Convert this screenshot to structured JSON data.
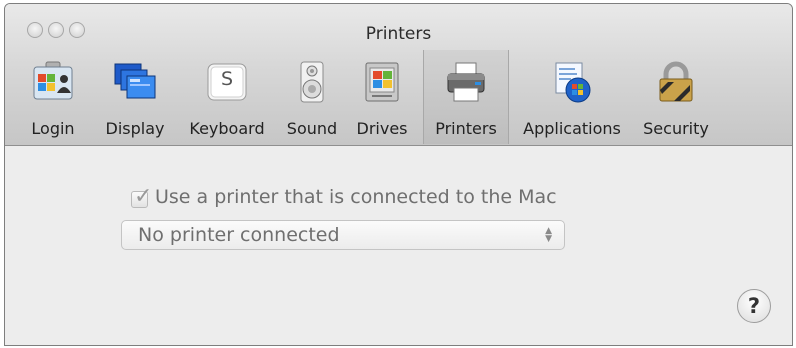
{
  "window": {
    "title": "Printers"
  },
  "toolbar": {
    "items": [
      {
        "label": "Login",
        "icon": "login-icon",
        "selected": false
      },
      {
        "label": "Display",
        "icon": "display-icon",
        "selected": false
      },
      {
        "label": "Keyboard",
        "icon": "keyboard-icon",
        "selected": false,
        "key_glyph": "S"
      },
      {
        "label": "Sound",
        "icon": "speaker-icon",
        "selected": false
      },
      {
        "label": "Drives",
        "icon": "drive-icon",
        "selected": false
      },
      {
        "label": "Printers",
        "icon": "printer-icon",
        "selected": true
      },
      {
        "label": "Applications",
        "icon": "applications-icon",
        "selected": false
      },
      {
        "label": "Security",
        "icon": "lock-icon",
        "selected": false
      }
    ]
  },
  "printers": {
    "use_printer_label": "Use a printer that is connected to the Mac",
    "use_printer_checked": true,
    "printer_select_value": "No printer connected"
  },
  "help": {
    "glyph": "?"
  }
}
